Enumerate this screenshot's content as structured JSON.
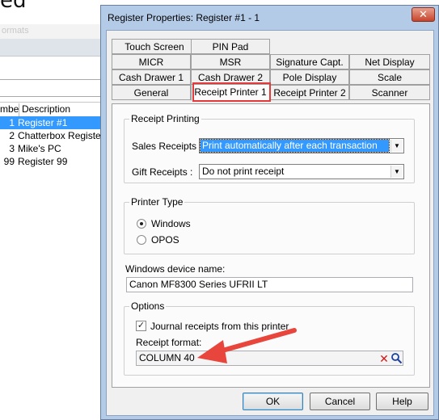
{
  "background": {
    "title_fragment": "ed",
    "faint_text": "ormats",
    "list": {
      "headers": [
        "mber",
        "Description"
      ],
      "rows": [
        {
          "num": "1",
          "desc": "Register #1",
          "selected": true
        },
        {
          "num": "2",
          "desc": "Chatterbox Register",
          "selected": false
        },
        {
          "num": "3",
          "desc": "Mike's PC",
          "selected": false
        },
        {
          "num": "99",
          "desc": "Register 99",
          "selected": false
        }
      ]
    }
  },
  "dialog": {
    "title": "Register Properties: Register #1 - 1",
    "close_glyph": "✕",
    "tabs_row1": [
      "Touch Screen",
      "PIN Pad"
    ],
    "tabs_row2": [
      "MICR",
      "MSR",
      "Signature Capt.",
      "Net Display"
    ],
    "tabs_row3": [
      "Cash Drawer 1",
      "Cash Drawer 2",
      "Pole Display",
      "Scale"
    ],
    "tabs_row4": [
      "General",
      "Receipt Printer 1",
      "Receipt Printer 2",
      "Scanner"
    ],
    "active_tab": "Receipt Printer 1",
    "highlight_color": "#e23a3a",
    "receipt_printing": {
      "group_label": "Receipt Printing",
      "sales_label": "Sales Receipts :",
      "sales_value": "Print automatically after each transaction",
      "gift_label": "Gift Receipts :",
      "gift_value": "Do not print receipt"
    },
    "printer_type": {
      "group_label": "Printer Type",
      "options": [
        {
          "label": "Windows",
          "selected": true
        },
        {
          "label": "OPOS",
          "selected": false
        }
      ]
    },
    "device_name": {
      "label": "Windows device name:",
      "value": "Canon MF8300 Series UFRII LT"
    },
    "options": {
      "group_label": "Options",
      "journal_label": "Journal receipts from this printer",
      "journal_checked": true,
      "format_label": "Receipt format:",
      "format_value": "COLUMN 40",
      "clear_icon": "clear-icon",
      "search_icon": "search-icon"
    },
    "buttons": {
      "ok": "OK",
      "cancel": "Cancel",
      "help": "Help"
    },
    "annotation_arrow_color": "#e8453c"
  }
}
